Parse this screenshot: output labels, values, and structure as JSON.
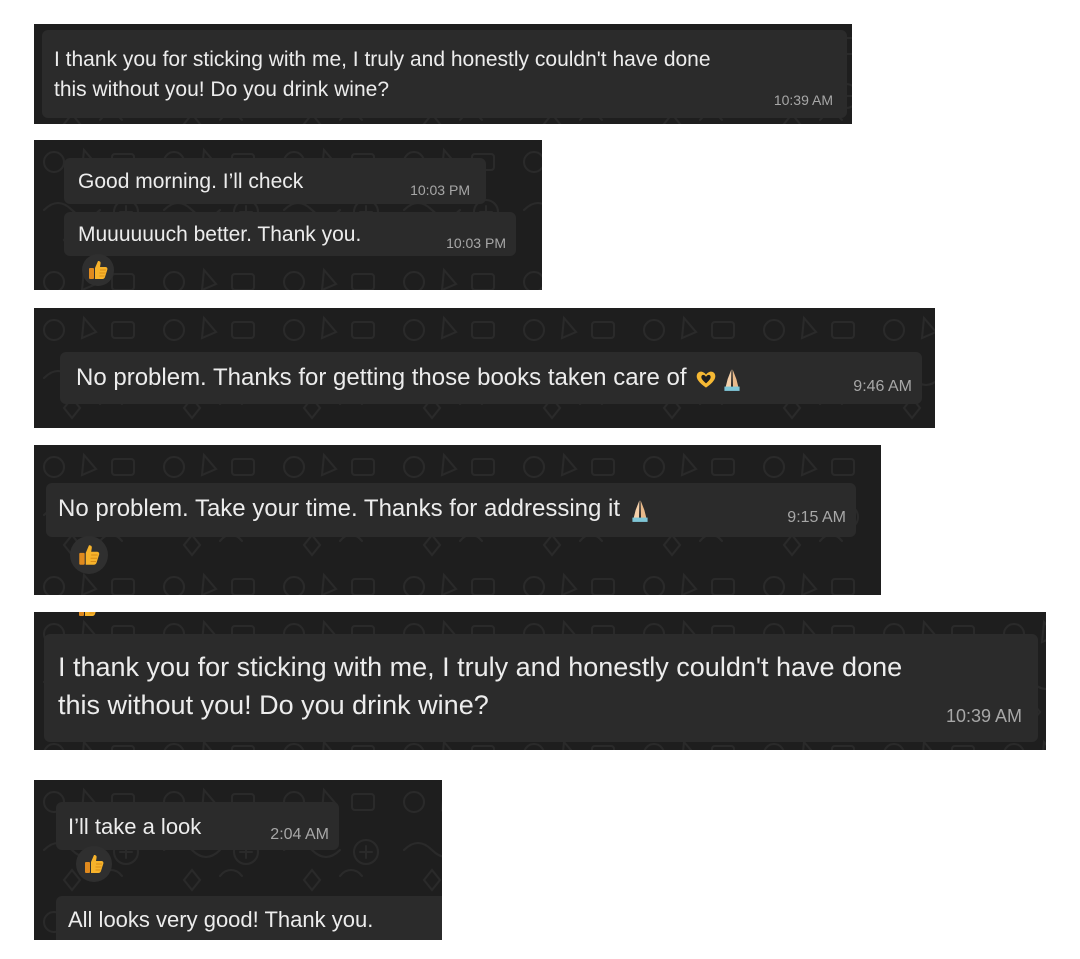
{
  "panels": [
    {
      "messages": [
        {
          "lines": [
            "I thank you for sticking with me, I truly and honestly couldn't have done",
            "this without you!  Do you drink wine?"
          ],
          "time": "10:39 AM"
        }
      ]
    },
    {
      "messages": [
        {
          "text": "Good morning. I’ll check",
          "time": "10:03 PM"
        },
        {
          "text": "Muuuuuuch better. Thank you.",
          "time": "10:03 PM",
          "reaction": "thumbs-up"
        }
      ]
    },
    {
      "messages": [
        {
          "text": "No problem. Thanks for getting those books taken care of",
          "emojis": [
            "heart-hands",
            "folded-hands"
          ],
          "time": "9:46 AM"
        }
      ]
    },
    {
      "messages": [
        {
          "text": "No problem. Take your time. Thanks for addressing it",
          "emojis": [
            "folded-hands"
          ],
          "time": "9:15 AM",
          "reaction": "thumbs-up"
        }
      ]
    },
    {
      "messages": [
        {
          "lines": [
            "I thank you for sticking with me, I truly and honestly couldn't have done",
            "this without you!  Do you drink wine?"
          ],
          "time": "10:39 AM"
        }
      ]
    },
    {
      "messages": [
        {
          "text": "I’ll take a look",
          "time": "2:04 AM",
          "reaction": "thumbs-up"
        },
        {
          "text": "All looks very good! Thank you."
        }
      ]
    }
  ],
  "colors": {
    "panel_bg": "#1e1e1e",
    "bubble_bg": "#2b2b2b",
    "text": "#ececec",
    "timestamp": "#a7a7a7",
    "thumbs": "#f4b400"
  }
}
